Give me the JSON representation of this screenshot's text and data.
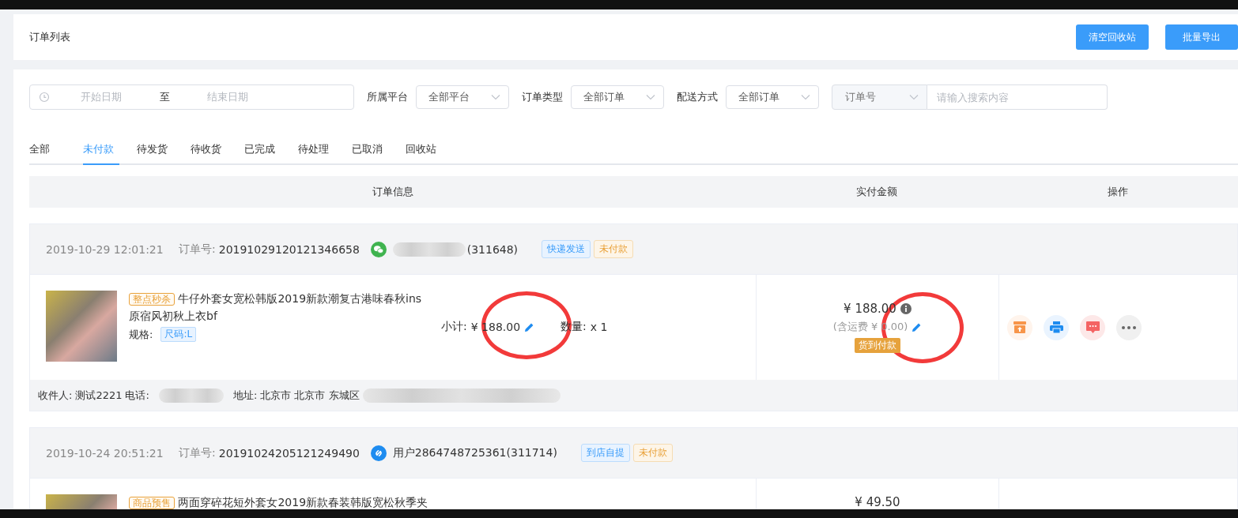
{
  "header": {
    "title": "订单列表",
    "buttons": [
      "清空回收站",
      "批量导出"
    ]
  },
  "filters": {
    "date": {
      "start_placeholder": "开始日期",
      "separator": "至",
      "end_placeholder": "结束日期"
    },
    "selects": [
      {
        "label": "所属平台",
        "value": "全部平台"
      },
      {
        "label": "订单类型",
        "value": "全部订单"
      },
      {
        "label": "配送方式",
        "value": "全部订单"
      }
    ],
    "search": {
      "type_value": "订单号",
      "placeholder": "请输入搜索内容"
    }
  },
  "tabs": [
    {
      "label": "全部",
      "selected": false
    },
    {
      "label": "未付款",
      "selected": true
    },
    {
      "label": "待发货",
      "selected": false
    },
    {
      "label": "待收货",
      "selected": false
    },
    {
      "label": "已完成",
      "selected": false
    },
    {
      "label": "待处理",
      "selected": false
    },
    {
      "label": "已取消",
      "selected": false
    },
    {
      "label": "回收站",
      "selected": false
    }
  ],
  "table": {
    "columns": [
      "订单信息",
      "实付金额",
      "操作"
    ]
  },
  "orders": [
    {
      "time": "2019-10-29 12:01:21",
      "order_no_label": "订单号:",
      "order_no": "20191029120121346658",
      "kind": "wechat",
      "buyer": "(311648)",
      "buyer_blurred": true,
      "tags": [
        {
          "text": "快递发送",
          "kind": "delivery"
        },
        {
          "text": "未付款",
          "kind": "status"
        }
      ],
      "product": {
        "promo": "整点秒杀",
        "title": "牛仔外套女宽松韩版2019新款潮复古港味春秋ins原宿风初秋上衣bf",
        "spec_label": "规格:",
        "spec": "尺码:L",
        "subtotal_label": "小计:",
        "subtotal": "¥ 188.00",
        "qty_label": "数量:",
        "qty": "x 1"
      },
      "price": "¥ 188.00",
      "shipping_note": "(含运费 ¥ 0.00)",
      "pay_tag": "货到付款",
      "annotated": true,
      "recipient": {
        "name_label": "收件人:",
        "name": "测试2221",
        "phone_label": "电话:",
        "address_label": "地址:",
        "address": "北京市 北京市 东城区"
      }
    },
    {
      "time": "2019-10-24 20:51:21",
      "order_no_label": "订单号:",
      "order_no": "20191024205121249490",
      "kind": "miniapp",
      "buyer": "用户2864748725361(311714)",
      "buyer_blurred": false,
      "tags": [
        {
          "text": "到店自提",
          "kind": "delivery"
        },
        {
          "text": "未付款",
          "kind": "status"
        }
      ],
      "product": {
        "promo": "商品预售",
        "title": "两面穿碎花短外套女2019新款春装韩版宽松秋季夹"
      },
      "price": "¥ 49.50",
      "annotated": false
    }
  ]
}
